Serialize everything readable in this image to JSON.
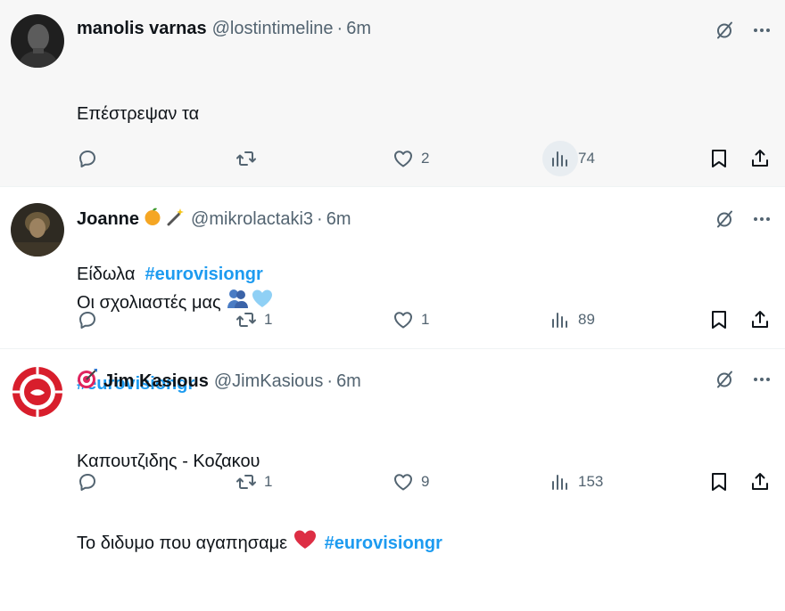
{
  "tweets": [
    {
      "name": "manolis varnas",
      "handle": "@lostintimeline",
      "separator": "·",
      "time": "6m",
      "lines": [
        {
          "text": "Επέστρεψαν τα",
          "hashtag": ""
        },
        {
          "text": "",
          "hashtag": ""
        },
        {
          "text": "Είδωλα  ",
          "hashtag": "#eurovisiongr"
        }
      ],
      "replies": "",
      "retweets": "",
      "likes": "2",
      "views": "74"
    },
    {
      "name": "Joanne",
      "name_emojis": [
        "orange-emoji",
        "magic-wand-emoji"
      ],
      "handle": "@mikrolactaki3",
      "separator": "·",
      "time": "6m",
      "lines": [
        {
          "text": "Οι σχολιαστές μας ",
          "hashtag": ""
        },
        {
          "text": "",
          "hashtag": "#eurovisiongr"
        }
      ],
      "replies": "",
      "retweets": "1",
      "likes": "1",
      "views": "89"
    },
    {
      "name": "Jim Kasious",
      "name_prefix_emoji": "direct-hit-emoji",
      "handle": "@JimKasious",
      "separator": "·",
      "time": "6m",
      "lines": [
        {
          "text": "Καπουτζιδης - Κοζακου",
          "hashtag": ""
        },
        {
          "text": "Το διδυμο που αγαπησαμε ",
          "hashtag": "#eurovisiongr"
        }
      ],
      "replies": "",
      "retweets": "1",
      "likes": "9",
      "views": "153"
    }
  ],
  "colors": {
    "accent": "#1d9bf0",
    "text": "#0f1419",
    "muted": "#536471",
    "heart": "#e0245e"
  },
  "icons": [
    "grok-icon",
    "more-icon",
    "reply-icon",
    "retweet-icon",
    "like-icon",
    "views-icon",
    "bookmark-icon",
    "share-icon"
  ]
}
